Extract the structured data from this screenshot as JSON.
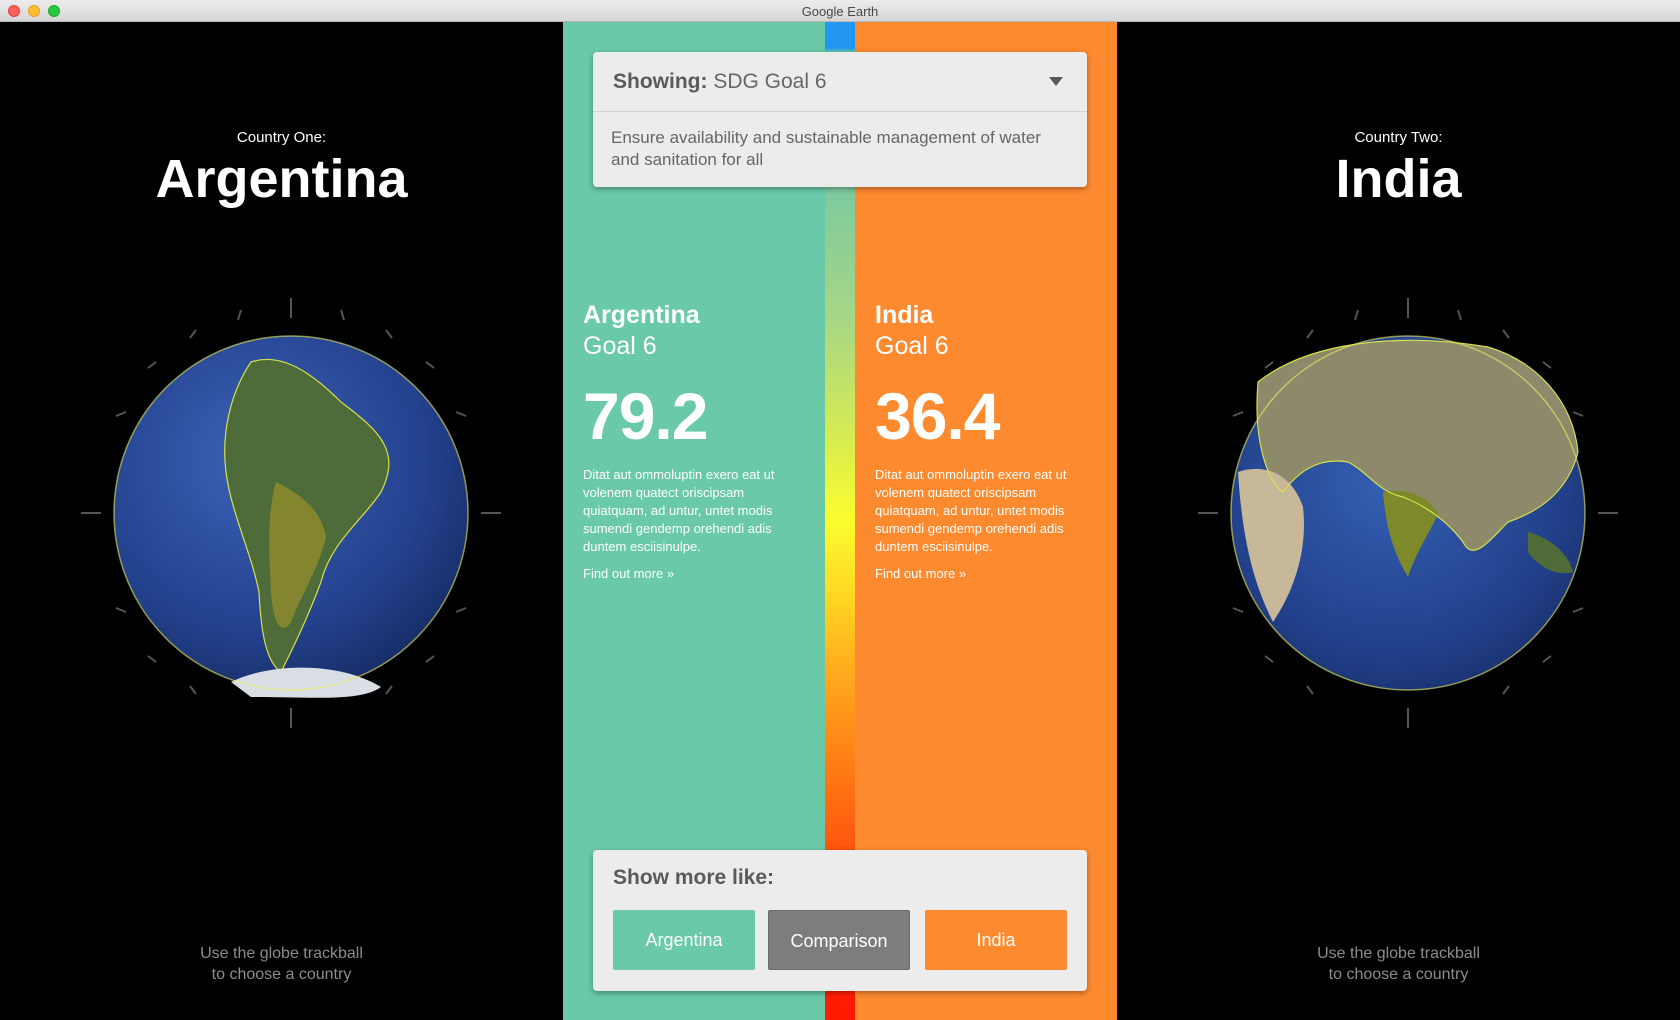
{
  "window": {
    "title": "Google Earth"
  },
  "left_panel": {
    "caption": "Country One:",
    "country": "Argentina",
    "hint_line1": "Use the globe trackball",
    "hint_line2": "to choose a country",
    "globe_icon": "globe-south-america-icon"
  },
  "right_panel": {
    "caption": "Country Two:",
    "country": "India",
    "hint_line1": "Use the globe trackball",
    "hint_line2": "to choose a country",
    "globe_icon": "globe-asia-icon"
  },
  "goal_selector": {
    "prefix": "Showing:",
    "value": "SDG Goal 6",
    "description": "Ensure availability and sustainable management of water and sanitation for all"
  },
  "scores": {
    "left": {
      "country": "Argentina",
      "goal": "Goal 6",
      "value": "79.2",
      "description": "Ditat aut ommoluptin exero eat ut volenem quatect oriscipsam quiatquam, ad untur, untet modis sumendi gendemp orehendi adis duntem esciisinulpe.",
      "link": "Find out more »"
    },
    "right": {
      "country": "India",
      "goal": "Goal 6",
      "value": "36.4",
      "description": "Ditat aut ommoluptin exero eat ut volenem quatect oriscipsam quiatquam, ad untur, untet modis sumendi gendemp orehendi adis duntem esciisinulpe.",
      "link": "Find out more »"
    }
  },
  "show_more": {
    "heading": "Show more like:",
    "buttons": [
      "Argentina",
      "Comparison",
      "India"
    ]
  },
  "colors": {
    "country_one": "#6ac9a9",
    "country_two": "#fe8a2f",
    "comparison": "#7d7d7d"
  }
}
